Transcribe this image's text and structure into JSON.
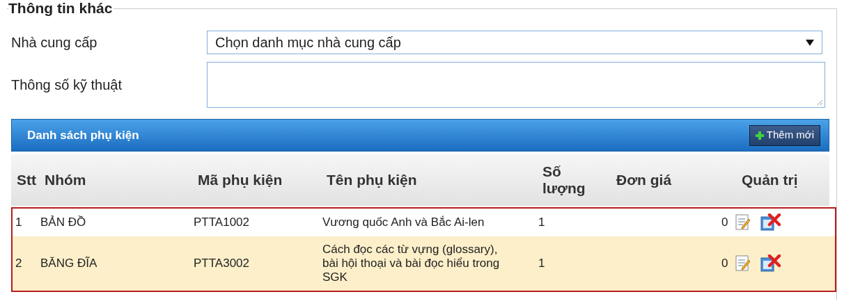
{
  "section": {
    "legend": "Thông tin khác"
  },
  "form": {
    "supplier_label": "Nhà cung cấp",
    "supplier_value": "Chọn danh mục nhà cung cấp",
    "specs_label": "Thông số kỹ thuật"
  },
  "panel": {
    "title": "Danh sách phụ kiện",
    "add_button": "Thêm mới"
  },
  "table": {
    "columns": [
      "Stt",
      "Nhóm",
      "Mã phụ kiện",
      "Tên phụ kiện",
      "Số lượng",
      "Đơn giá",
      "Quản trị"
    ],
    "rows": [
      {
        "stt": "1",
        "group": "BẢN ĐỒ",
        "code": "PTTA1002",
        "name": "Vương quốc Anh và Bắc Ai-len",
        "qty": "1",
        "price_count": "0",
        "highlighted": false
      },
      {
        "stt": "2",
        "group": "BĂNG ĐĨA",
        "code": "PTTA3002",
        "name": "Cách đọc các từ vựng (glossary), bài hội thoại và bài đọc hiểu trong SGK",
        "qty": "1",
        "price_count": "0",
        "highlighted": true
      }
    ]
  }
}
